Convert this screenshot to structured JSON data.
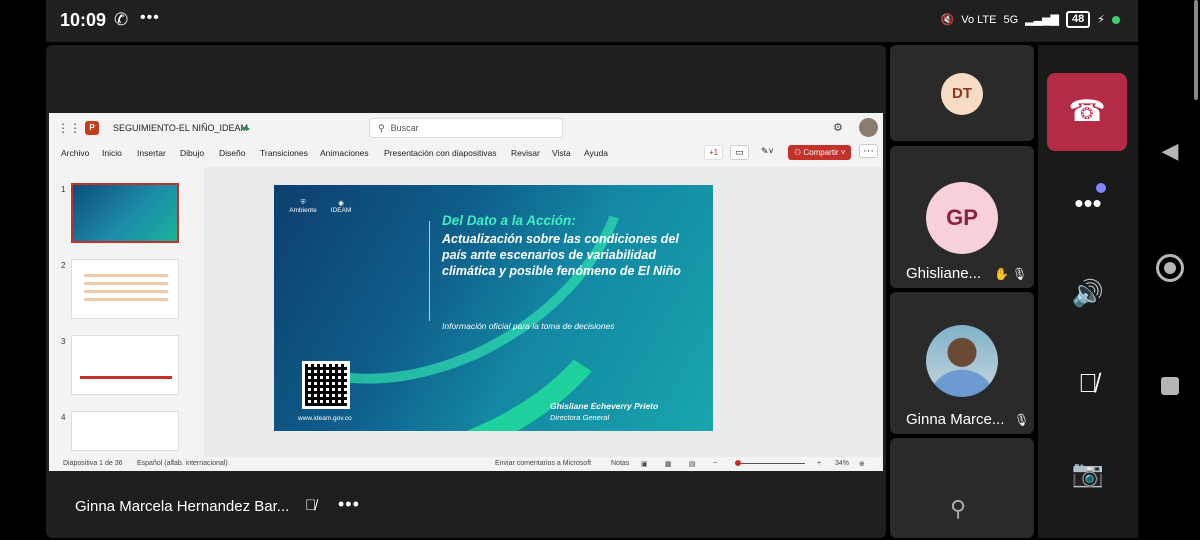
{
  "status": {
    "time": "10:09",
    "network": "Vo LTE",
    "signal": "5G",
    "battery": "48"
  },
  "ppt": {
    "doc_title": "SEGUIMIENTO-EL NIÑO_IDEAM",
    "search_placeholder": "Buscar",
    "menu": [
      "Archivo",
      "Inicio",
      "Insertar",
      "Dibujo",
      "Diseño",
      "Transiciones",
      "Animaciones",
      "Presentación con diapositivas",
      "Revisar",
      "Vista",
      "Ayuda"
    ],
    "plus_count": "+1",
    "share_label": "Compartir",
    "thumbnails": [
      "1",
      "2",
      "3",
      "4"
    ],
    "statusbar": {
      "slide_info": "Diapositiva 1 de 36",
      "language": "Español (alfab. internacional)",
      "feedback": "Enviar comentarios a Microsoft",
      "notes": "Notas",
      "zoom": "34%"
    }
  },
  "slide": {
    "logo1": "Ambiente",
    "logo2": "IDEAM",
    "title_accent": "Del Dato a la Acción:",
    "title_main": "Actualización sobre las condiciones del país ante escenarios de variabilidad climática y posible fenómeno de El Niño",
    "subtitle": "Información oficial para la toma de decisiones",
    "url": "www.ideam.gov.co",
    "author": "Ghisliane Echeverry Prieto",
    "role": "Directora General"
  },
  "stage": {
    "speaker": "Ginna Marcela Hernandez Bar..."
  },
  "participants": [
    {
      "initials": "DT",
      "name": ""
    },
    {
      "initials": "GP",
      "name": "Ghisliane..."
    },
    {
      "initials": "",
      "name": "Ginna Marce..."
    }
  ],
  "colors": {
    "end_call": "#b32b45",
    "share": "#c4312b",
    "slide_accent": "#3ff0c0"
  }
}
